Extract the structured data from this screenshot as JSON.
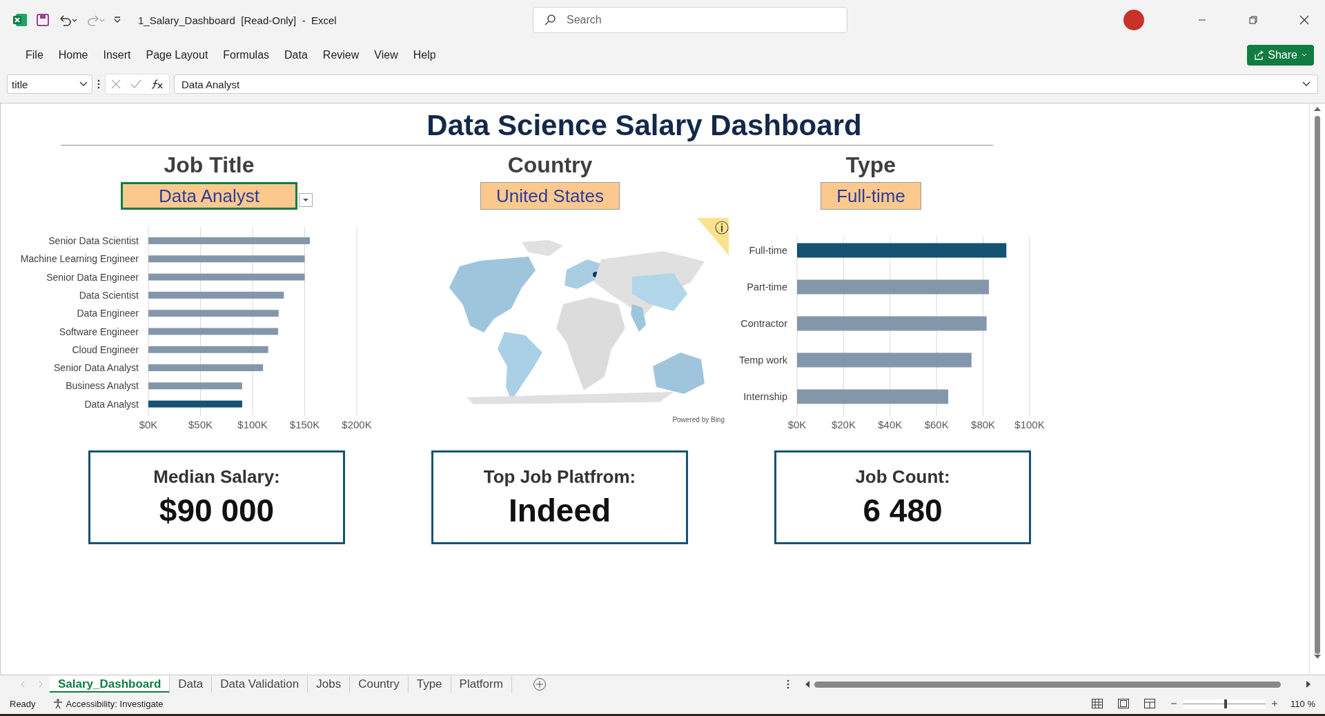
{
  "window": {
    "title": "1_Salary_Dashboard  [Read-Only]  -  Excel"
  },
  "search": {
    "placeholder": "Search"
  },
  "ribbon_tabs": [
    "File",
    "Home",
    "Insert",
    "Page Layout",
    "Formulas",
    "Data",
    "Review",
    "View",
    "Help"
  ],
  "share_button": "Share",
  "formula_bar": {
    "name_box": "title",
    "value": "Data Analyst"
  },
  "dashboard": {
    "title": "Data Science Salary Dashboard",
    "filters": [
      {
        "label": "Job Title",
        "value": "Data Analyst",
        "selected": true
      },
      {
        "label": "Country",
        "value": "United States",
        "selected": false
      },
      {
        "label": "Type",
        "value": "Full-time",
        "selected": false
      }
    ],
    "job_chart": {
      "chart_data": {
        "type": "bar",
        "orientation": "horizontal",
        "stacked": true,
        "grid": true,
        "categories": [
          "Senior Data Scientist",
          "Machine Learning Engineer",
          "Senior Data Engineer",
          "Data Scientist",
          "Data Engineer",
          "Software Engineer",
          "Cloud Engineer",
          "Senior Data Analyst",
          "Business Analyst",
          "Data Analyst"
        ],
        "series": [
          {
            "color": "#8497aa",
            "values": [
              155000,
              150000,
              150000,
              130000,
              125000,
              124500,
              115000,
              110000,
              90000,
              null
            ]
          },
          {
            "color": "#145372",
            "values": [
              null,
              null,
              null,
              null,
              null,
              null,
              null,
              null,
              null,
              90000
            ]
          }
        ],
        "xlim": [
          0,
          200000
        ],
        "xticks": [
          {
            "value": 0,
            "label": "$0K"
          },
          {
            "value": 50000,
            "label": "$50K"
          },
          {
            "value": 100000,
            "label": "$100K"
          },
          {
            "value": 150000,
            "label": "$150K"
          },
          {
            "value": 200000,
            "label": "$200K"
          }
        ]
      }
    },
    "map": {
      "credit": "Powered by Bing"
    },
    "type_chart": {
      "chart_data": {
        "type": "bar",
        "orientation": "horizontal",
        "stacked": true,
        "grid": true,
        "categories": [
          "Full-time",
          "Part-time",
          "Contractor",
          "Temp work",
          "Internship"
        ],
        "series": [
          {
            "color": "#8497aa",
            "values": [
              null,
              82500,
              81500,
              75000,
              65000
            ]
          },
          {
            "color": "#145372",
            "values": [
              90000,
              null,
              null,
              null,
              null
            ]
          }
        ],
        "xlim": [
          0,
          100000
        ],
        "xticks": [
          {
            "value": 0,
            "label": "$0K"
          },
          {
            "value": 20000,
            "label": "$20K"
          },
          {
            "value": 40000,
            "label": "$40K"
          },
          {
            "value": 60000,
            "label": "$60K"
          },
          {
            "value": 80000,
            "label": "$80K"
          },
          {
            "value": 100000,
            "label": "$100K"
          }
        ]
      }
    },
    "kpis": [
      {
        "label": "Median Salary:",
        "value": "$90 000"
      },
      {
        "label": "Top Job Platfrom:",
        "value": "Indeed"
      },
      {
        "label": "Job Count:",
        "value": "6 480"
      }
    ]
  },
  "sheet_tabs": [
    {
      "label": "Salary_Dashboard",
      "selected": true
    },
    {
      "label": "Data",
      "selected": false
    },
    {
      "label": "Data Validation",
      "selected": false
    },
    {
      "label": "Jobs",
      "selected": false
    },
    {
      "label": "Country",
      "selected": false
    },
    {
      "label": "Type",
      "selected": false
    },
    {
      "label": "Platform",
      "selected": false
    }
  ],
  "status_bar": {
    "status": "Ready",
    "accessibility": "Accessibility: Investigate",
    "zoom": "110 %",
    "level": 0.5
  }
}
